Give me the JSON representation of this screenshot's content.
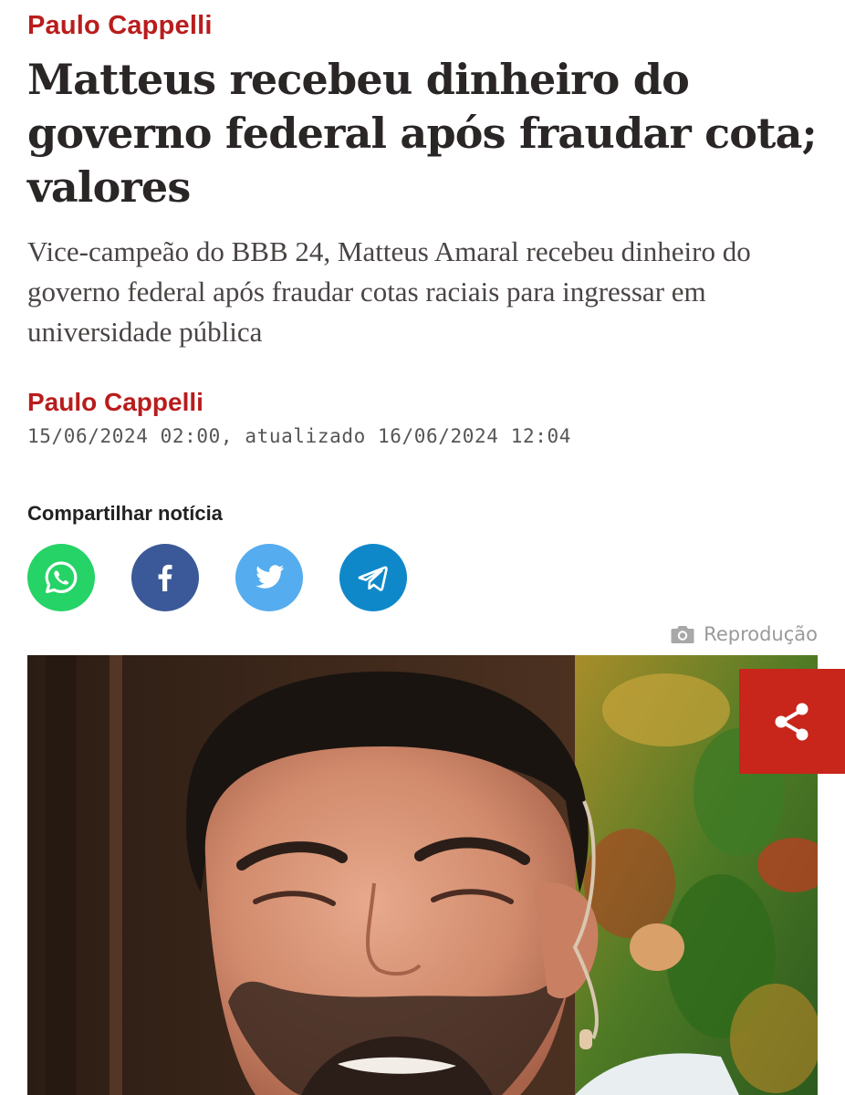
{
  "header": {
    "section": "Paulo Cappelli"
  },
  "article": {
    "headline": "Matteus recebeu dinheiro do governo federal após fraudar cota; valores",
    "subtitle": "Vice-campeão do BBB 24, Matteus Amaral recebeu dinheiro do governo federal após fraudar cotas raciais para ingressar em universidade pública",
    "author": "Paulo Cappelli",
    "dateline": "15/06/2024 02:00, atualizado 16/06/2024 12:04"
  },
  "share": {
    "heading": "Compartilhar notícia",
    "buttons": [
      {
        "network": "whatsapp",
        "icon": "whatsapp-icon",
        "color": "#25d366"
      },
      {
        "network": "facebook",
        "icon": "facebook-icon",
        "color": "#3b5998"
      },
      {
        "network": "twitter",
        "icon": "twitter-icon",
        "color": "#55acee"
      },
      {
        "network": "telegram",
        "icon": "telegram-icon",
        "color": "#0f88c9"
      }
    ]
  },
  "photo": {
    "credit": "Reprodução",
    "credit_icon": "camera-icon",
    "share_icon": "share-icon",
    "share_color": "#c8251b"
  },
  "colors": {
    "accent": "#b91c1c",
    "headline": "#2b2626",
    "text": "#4a4444",
    "muted": "#9a9a9a"
  }
}
